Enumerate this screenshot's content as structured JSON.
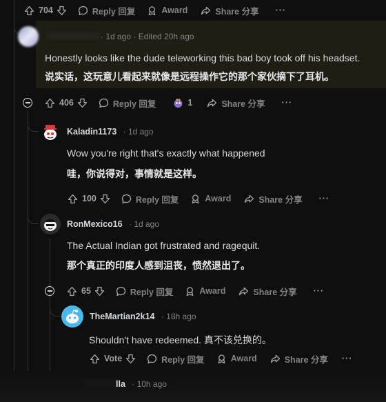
{
  "top_actions": {
    "count": "704",
    "reply": "Reply 回复",
    "award": "Award",
    "share": "Share 分享",
    "more": "···"
  },
  "comment1": {
    "meta": "· 1d ago · Edited 20h ago",
    "text_en": "Honestly looks like the dude teleworking this bad boy took off his headset.",
    "text_zh": "说实话，这玩意儿看起来就像是远程操作它的那个家伙摘下了耳机。",
    "actions": {
      "count": "406",
      "reply": "Reply 回复",
      "award_count": "1",
      "share": "Share 分享",
      "more": "···"
    },
    "highlight_color": "#1f1d14"
  },
  "comment2": {
    "user": "Kaladin1173",
    "time": "· 1d ago",
    "text_en": "Wow you're right that's exactly what happened",
    "text_zh": "哇，你说得对，事情就是这样。",
    "actions": {
      "count": "100",
      "reply": "Reply 回复",
      "award": "Award",
      "share": "Share 分享",
      "more": "···"
    }
  },
  "comment3": {
    "user": "RonMexico16",
    "time": "· 1d ago",
    "text_en": "The Actual Indian got frustrated and ragequit.",
    "text_zh": "那个真正的印度人感到沮丧，愤然退出了。",
    "actions": {
      "count": "65",
      "reply": "Reply 回复",
      "award": "Award",
      "share": "Share 分享",
      "more": "···"
    }
  },
  "comment4": {
    "user": "TheMartian2k14",
    "time": "· 18h ago",
    "text": "Shouldn't have redeemed. 真不该兑换的。",
    "actions": {
      "vote": "Vote",
      "reply": "Reply 回复",
      "award": "Award",
      "share": "Share 分享",
      "more": "···"
    }
  },
  "comment5": {
    "user": "lla",
    "time": "· 10h ago"
  }
}
